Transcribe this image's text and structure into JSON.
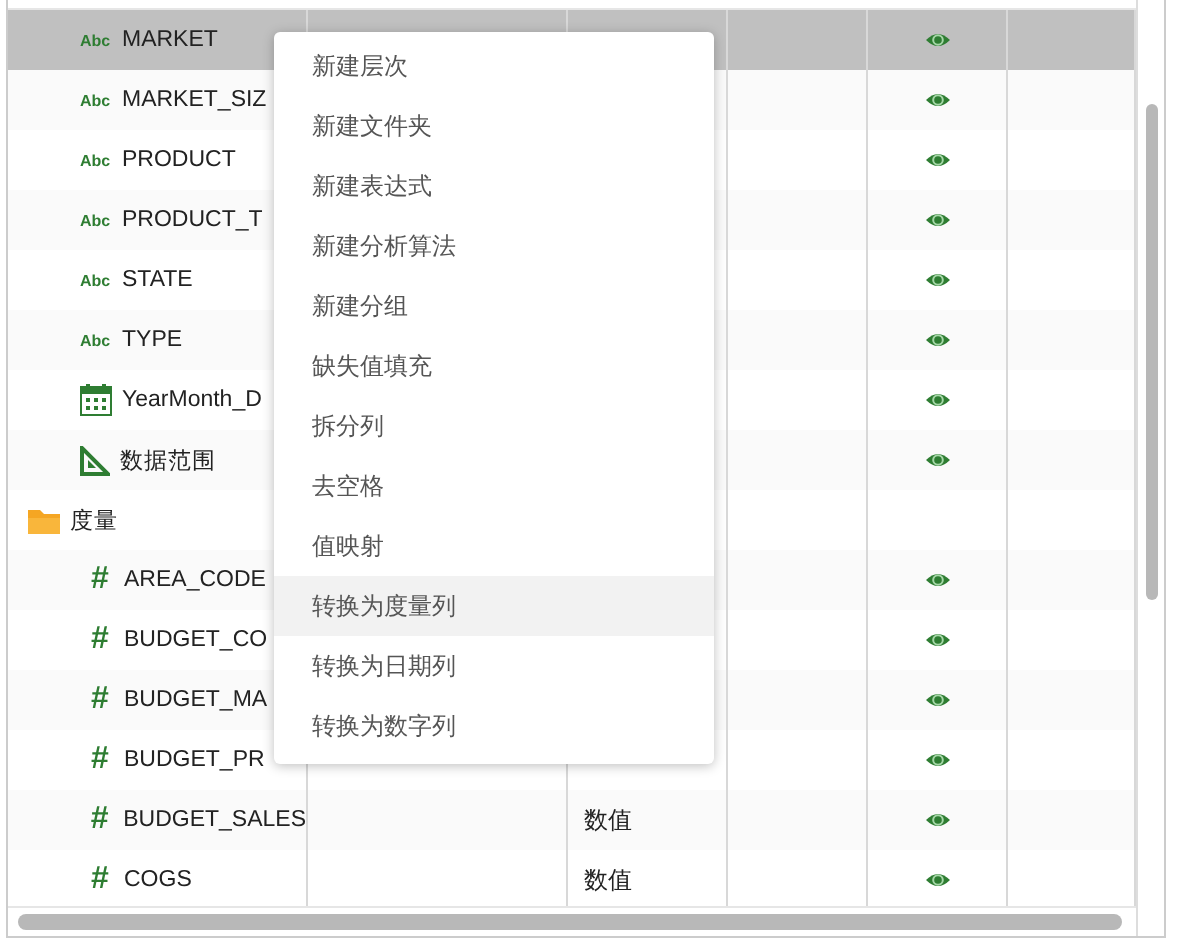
{
  "dimension_fields": [
    {
      "kind": "text",
      "type_label": "Abc",
      "name": "MARKET",
      "selected": true,
      "visible": true
    },
    {
      "kind": "text",
      "type_label": "Abc",
      "name": "MARKET_SIZ",
      "selected": false,
      "visible": true
    },
    {
      "kind": "text",
      "type_label": "Abc",
      "name": "PRODUCT",
      "selected": false,
      "visible": true
    },
    {
      "kind": "text",
      "type_label": "Abc",
      "name": "PRODUCT_T",
      "selected": false,
      "visible": true
    },
    {
      "kind": "text",
      "type_label": "Abc",
      "name": "STATE",
      "selected": false,
      "visible": true
    },
    {
      "kind": "text",
      "type_label": "Abc",
      "name": "TYPE",
      "selected": false,
      "visible": true
    },
    {
      "kind": "date",
      "name": "YearMonth_D",
      "selected": false,
      "visible": true
    },
    {
      "kind": "range",
      "name": "数据范围",
      "selected": false,
      "visible": true
    }
  ],
  "measure_folder": {
    "label": "度量",
    "expanded": true,
    "children": [
      {
        "kind": "number",
        "type_label": "#",
        "name": "AREA_CODE",
        "selected": false,
        "visible": true
      },
      {
        "kind": "number",
        "type_label": "#",
        "name": "BUDGET_CO",
        "selected": false,
        "visible": true
      },
      {
        "kind": "number",
        "type_label": "#",
        "name": "BUDGET_MA",
        "selected": false,
        "visible": true
      },
      {
        "kind": "number",
        "type_label": "#",
        "name": "BUDGET_PR",
        "selected": false,
        "visible": true
      },
      {
        "kind": "number",
        "type_label": "#",
        "name": "BUDGET_SALES",
        "data_type": "数值",
        "selected": false,
        "visible": true
      },
      {
        "kind": "number",
        "type_label": "#",
        "name": "COGS",
        "data_type": "数值",
        "selected": false,
        "visible": true
      }
    ]
  },
  "context_menu": [
    {
      "label": "新建层次",
      "hovered": false
    },
    {
      "label": "新建文件夹",
      "hovered": false
    },
    {
      "label": "新建表达式",
      "hovered": false
    },
    {
      "label": "新建分析算法",
      "hovered": false
    },
    {
      "label": "新建分组",
      "hovered": false
    },
    {
      "label": "缺失值填充",
      "hovered": false
    },
    {
      "label": "拆分列",
      "hovered": false
    },
    {
      "label": "去空格",
      "hovered": false
    },
    {
      "label": "值映射",
      "hovered": false
    },
    {
      "label": "转换为度量列",
      "hovered": true
    },
    {
      "label": "转换为日期列",
      "hovered": false
    },
    {
      "label": "转换为数字列",
      "hovered": false
    }
  ]
}
